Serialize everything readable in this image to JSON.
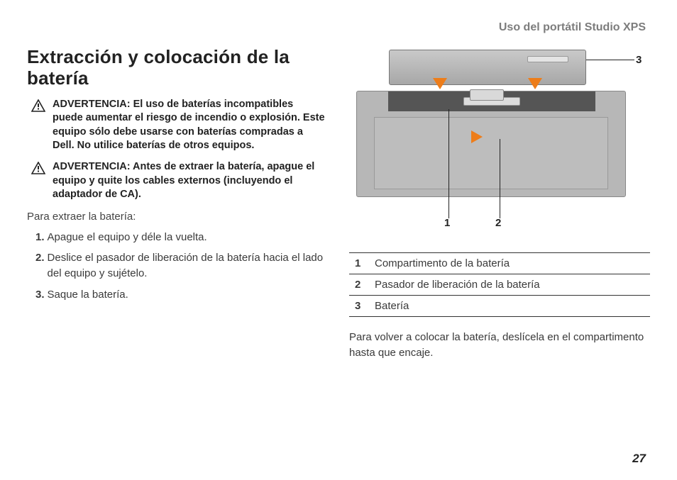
{
  "header": {
    "title": "Uso del portátil Studio XPS"
  },
  "section": {
    "title": "Extracción y colocación de la batería"
  },
  "warnings": [
    {
      "text": "ADVERTENCIA: El uso de baterías incompatibles puede aumentar el riesgo de incendio o explosión. Este equipo sólo debe usarse con baterías compradas a Dell. No utilice baterías de otros equipos."
    },
    {
      "text": "ADVERTENCIA: Antes de extraer la batería, apague el equipo y quite los cables externos (incluyendo el adaptador de CA)."
    }
  ],
  "intro": "Para extraer la batería:",
  "steps": [
    "Apague el equipo y déle la vuelta.",
    "Deslice el pasador de liberación de la batería hacia el lado del equipo y sujételo.",
    "Saque la batería."
  ],
  "diagram": {
    "callouts": {
      "c1": "1",
      "c2": "2",
      "c3": "3"
    }
  },
  "legend": [
    {
      "num": "1",
      "desc": "Compartimento de la batería"
    },
    {
      "num": "2",
      "desc": "Pasador de liberación de la batería"
    },
    {
      "num": "3",
      "desc": "Batería"
    }
  ],
  "after": "Para volver a colocar la batería, deslícela en el compartimento hasta que encaje.",
  "page": "27"
}
